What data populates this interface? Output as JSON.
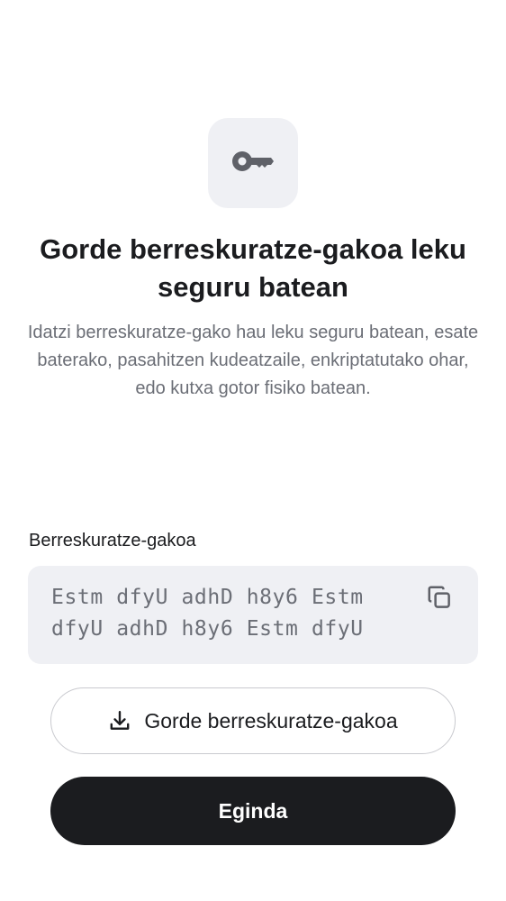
{
  "header": {
    "icon": "key-icon",
    "title": "Gorde berreskuratze-gakoa leku seguru batean",
    "description": "Idatzi berreskuratze-gako hau leku seguru batean, esate baterako, pasahitzen kudeatzaile, enkriptatutako ohar, edo kutxa gotor fisiko batean."
  },
  "recovery_key": {
    "label": "Berreskuratze-gakoa",
    "value": "Estm dfyU adhD h8y6 Estm dfyU adhD h8y6 Estm dfyU",
    "copy_icon": "copy-icon"
  },
  "actions": {
    "save_label": "Gorde berreskuratze-gakoa",
    "save_icon": "download-icon",
    "done_label": "Eginda"
  }
}
